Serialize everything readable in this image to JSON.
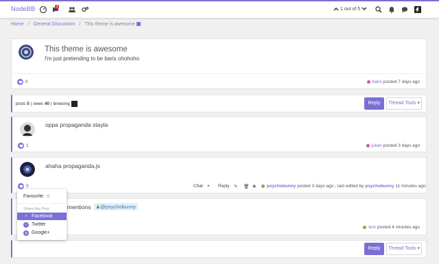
{
  "topbar": {
    "brand": "NodeBB",
    "notifications_count": "1",
    "pager": "1 out of 5",
    "icons": [
      "dashboard-icon",
      "notifications-icon",
      "users-icon",
      "settings-icon",
      "search-icon",
      "bell-icon",
      "chat-icon",
      "user-menu-icon"
    ]
  },
  "breadcrumb": {
    "home": "Home",
    "category": "General Discussion",
    "topic": "This theme is awesome"
  },
  "first_post": {
    "title": "This theme is awesome",
    "body": "I'm just pretending to be baris ohohoho",
    "votes": "0",
    "author": "baris",
    "author_color": "#d9539a",
    "posted": "posted 7 days ago"
  },
  "stats": {
    "posts_label": "posts",
    "posts": "5",
    "views_label": "views",
    "views": "40",
    "browsing_label": "browsing"
  },
  "buttons": {
    "reply": "Reply",
    "thread_tools": "Thread Tools"
  },
  "posts": [
    {
      "body": "oppa propaganda stayla",
      "votes": "1",
      "author": "julian",
      "author_color": "#d9539a",
      "posted": "posted 3 days ago"
    },
    {
      "body": "ahaha propaganda.js",
      "votes": "0",
      "author": "psychobunny",
      "author_color": "#7cb342",
      "posted": "posted 3 days ago",
      "edited": ", last edited by",
      "editor": "psychobunny",
      "edited_time": "11 minutes ago",
      "actions": {
        "chat": "Chat",
        "reply": "Reply"
      }
    },
    {
      "body_prefix": "mentions",
      "mention": "@psychobunny",
      "author": "test",
      "author_color": "#7cb342",
      "posted": "posted 4 minutes ago"
    }
  ],
  "dropdown": {
    "favourite": "Favourite",
    "section_label": "Share this Post",
    "items": [
      "Facebook",
      "Twitter",
      "Google+"
    ]
  }
}
